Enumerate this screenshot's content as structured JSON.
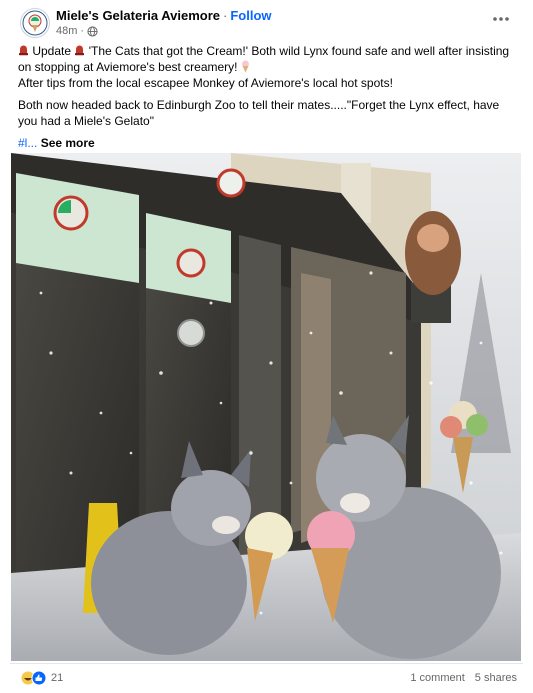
{
  "header": {
    "page_name": "Miele's Gelateria Aviemore",
    "separator": "·",
    "follow_label": "Follow",
    "time": "48m",
    "time_separator": "·"
  },
  "post": {
    "line1_prefix": "Update",
    "line1_rest": " 'The Cats that got the Cream!' Both wild Lynx found safe and well after insisting on stopping at Aviemore's best creamery!",
    "line2": "After tips from the local escapee Monkey of Aviemore's local hot spots!",
    "line3": "Both now headed back to Edinburgh Zoo to tell their mates.....\"Forget the Lynx effect, have you had a Miele's Gelato\"",
    "hashtag": "#l...",
    "see_more": "See more"
  },
  "footer": {
    "reaction_count": "21",
    "comments": "1 comment",
    "shares": "5 shares"
  },
  "colors": {
    "accent": "#0866ff",
    "secondary_text": "#65676b",
    "divider": "#e4e6eb"
  },
  "icons": {
    "alert": "red-alert-light-icon",
    "ice_cream": "ice-cream-icon",
    "reactions": [
      "haha-reaction-icon",
      "like-reaction-icon"
    ],
    "privacy": "globe-icon",
    "menu": "more-options-icon"
  }
}
